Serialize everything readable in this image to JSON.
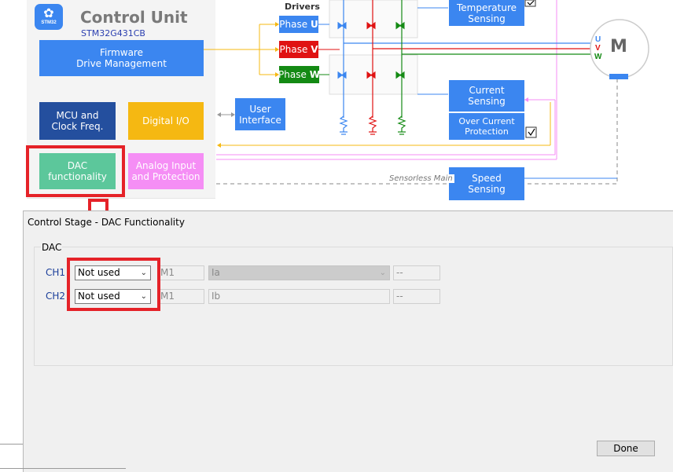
{
  "control_unit": {
    "title": "Control Unit",
    "chip": "STM32G431CB",
    "logo_text": "STM32",
    "blocks": {
      "firmware": "Firmware\nDrive Management",
      "mcu": "MCU and\nClock Freq.",
      "digital_io": "Digital I/O",
      "dac": "DAC\nfunctionality",
      "analog": "Analog Input\nand Protection"
    }
  },
  "user_interface": "User\nInterface",
  "drivers": {
    "title": "Drivers",
    "phases": [
      {
        "name": "Phase",
        "letter": "U",
        "color": "#3b86f0"
      },
      {
        "name": "Phase",
        "letter": "V",
        "color": "#e01212"
      },
      {
        "name": "Phase",
        "letter": "W",
        "color": "#148a14"
      }
    ]
  },
  "sensing": {
    "temperature": "Temperature\nSensing",
    "current": "Current\nSensing",
    "over_current": "Over Current\nProtection",
    "speed": "Speed\nSensing",
    "sensorless_label": "Sensorless Main"
  },
  "motor": {
    "label": "M",
    "phase_labels": [
      "U",
      "V",
      "W"
    ],
    "phase_colors": [
      "#3b86f0",
      "#e01212",
      "#148a14"
    ]
  },
  "dialog": {
    "title": "Control Stage - DAC Functionality",
    "group_label": "DAC",
    "channels": [
      {
        "label": "CH1",
        "select": "Not used",
        "motor": "M1",
        "signal": "Ia",
        "value": "--"
      },
      {
        "label": "CH2",
        "select": "Not used",
        "motor": "M1",
        "signal": "Ib",
        "value": "--"
      }
    ],
    "done_label": "Done"
  },
  "colors": {
    "highlight": "#e52228",
    "accent_blue": "#3b86f0"
  }
}
